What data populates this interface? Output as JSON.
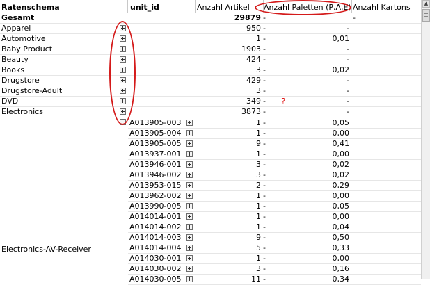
{
  "columns": {
    "ratenschema": "Ratenschema",
    "unit_id": "unit_id",
    "anzahl_artikel": "Anzahl Artikel",
    "anzahl_paletten": "Anzahl Paletten (P,A,E)",
    "anzahl_kartons": "Anzahl Kartons"
  },
  "total": {
    "label": "Gesamt",
    "artikel": "29879",
    "paletten": "-",
    "kartons": "-"
  },
  "categories": [
    {
      "name": "Apparel",
      "artikel": "950",
      "paletten": "-",
      "kartons": "-"
    },
    {
      "name": "Automotive",
      "artikel": "1",
      "paletten": "-",
      "kartons": "0,01"
    },
    {
      "name": "Baby Product",
      "artikel": "1903",
      "paletten": "-",
      "kartons": "-"
    },
    {
      "name": "Beauty",
      "artikel": "424",
      "paletten": "-",
      "kartons": "-"
    },
    {
      "name": "Books",
      "artikel": "3",
      "paletten": "-",
      "kartons": "0,02"
    },
    {
      "name": "Drugstore",
      "artikel": "429",
      "paletten": "-",
      "kartons": "-"
    },
    {
      "name": "Drugstore-Adult",
      "artikel": "3",
      "paletten": "-",
      "kartons": "-"
    },
    {
      "name": "DVD",
      "artikel": "349",
      "paletten": "-",
      "kartons": "-"
    },
    {
      "name": "Electronics",
      "artikel": "3873",
      "paletten": "-",
      "kartons": "-"
    }
  ],
  "group_label": "Electronics-AV-Receiver",
  "units": [
    {
      "id": "A013905-003",
      "artikel": "1",
      "paletten": "-",
      "kartons": "0,05"
    },
    {
      "id": "A013905-004",
      "artikel": "1",
      "paletten": "-",
      "kartons": "0,00"
    },
    {
      "id": "A013905-005",
      "artikel": "9",
      "paletten": "-",
      "kartons": "0,41"
    },
    {
      "id": "A013937-001",
      "artikel": "1",
      "paletten": "-",
      "kartons": "0,00"
    },
    {
      "id": "A013946-001",
      "artikel": "3",
      "paletten": "-",
      "kartons": "0,02"
    },
    {
      "id": "A013946-002",
      "artikel": "3",
      "paletten": "-",
      "kartons": "0,02"
    },
    {
      "id": "A013953-015",
      "artikel": "2",
      "paletten": "-",
      "kartons": "0,29"
    },
    {
      "id": "A013962-002",
      "artikel": "1",
      "paletten": "-",
      "kartons": "0,00"
    },
    {
      "id": "A013990-005",
      "artikel": "1",
      "paletten": "-",
      "kartons": "0,05"
    },
    {
      "id": "A014014-001",
      "artikel": "1",
      "paletten": "-",
      "kartons": "0,00"
    },
    {
      "id": "A014014-002",
      "artikel": "1",
      "paletten": "-",
      "kartons": "0,04"
    },
    {
      "id": "A014014-003",
      "artikel": "9",
      "paletten": "-",
      "kartons": "0,50"
    },
    {
      "id": "A014014-004",
      "artikel": "5",
      "paletten": "-",
      "kartons": "0,33"
    },
    {
      "id": "A014030-001",
      "artikel": "1",
      "paletten": "-",
      "kartons": "0,00"
    },
    {
      "id": "A014030-002",
      "artikel": "3",
      "paletten": "-",
      "kartons": "0,16"
    },
    {
      "id": "A014030-005",
      "artikel": "11",
      "paletten": "-",
      "kartons": "0,34"
    }
  ],
  "annotation": {
    "question_mark": "?",
    "color": "#d41a1a"
  },
  "icons": {
    "expand": "plus-box-icon",
    "collapse": "minus-box-icon",
    "scroll_up": "scroll-up-arrow-icon"
  }
}
